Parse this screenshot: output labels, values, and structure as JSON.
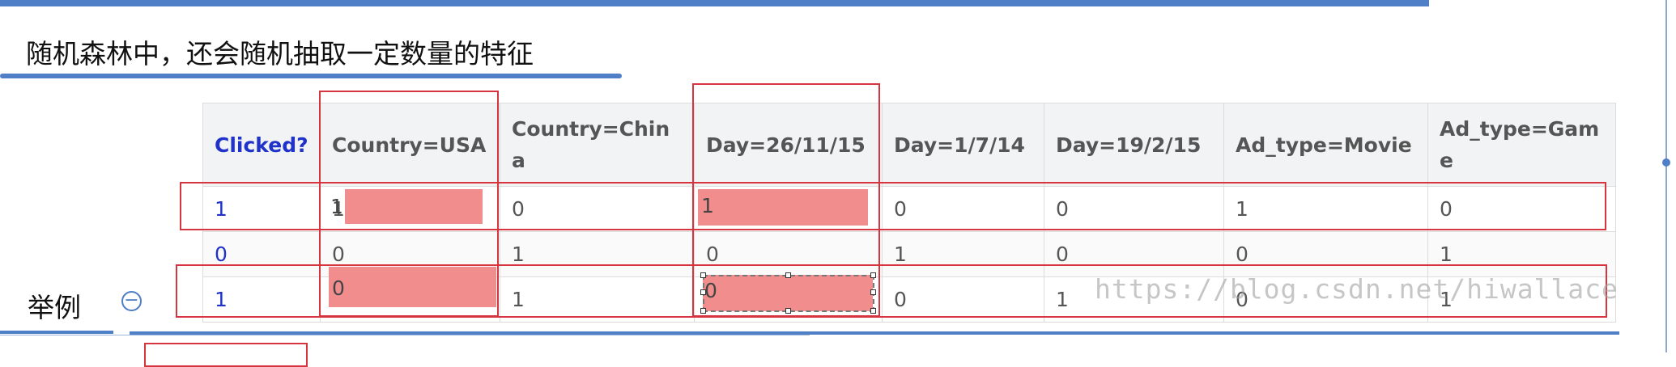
{
  "heading": "随机森林中，还会随机抽取一定数量的特征",
  "table": {
    "headers": [
      "Clicked?",
      "Country=USA",
      "Country=China",
      "Day=26/11/15",
      "Day=1/7/14",
      "Day=19/2/15",
      "Ad_type=Movie",
      "Ad_type=Game"
    ],
    "rows": [
      [
        "1",
        "1",
        "0",
        "1",
        "0",
        "0",
        "1",
        "0"
      ],
      [
        "0",
        "0",
        "1",
        "0",
        "1",
        "0",
        "0",
        "1"
      ],
      [
        "1",
        "0",
        "1",
        "0",
        "0",
        "1",
        "0",
        "1"
      ]
    ]
  },
  "example_label": "举例",
  "collapse_symbol": "−",
  "watermark": "https://blog.csdn.net/hiwallace",
  "colors": {
    "accent": "#4f7fc6",
    "highlight_fill": "#f28d8d",
    "box_outline": "#d6353f",
    "first_column_text": "#1f32c9"
  }
}
